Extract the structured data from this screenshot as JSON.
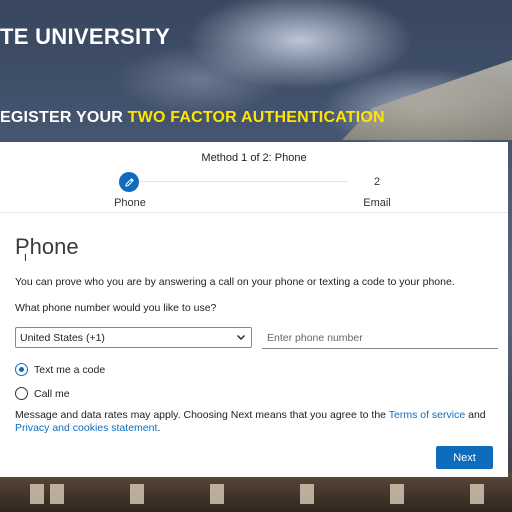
{
  "header": {
    "brand_text": "TE UNIVERSITY",
    "register_prefix": "EGISTER YOUR ",
    "register_highlight": "TWO FACTOR AUTHENTICATION"
  },
  "wizard": {
    "method_label": "Method 1 of 2: Phone",
    "steps": [
      {
        "number": "",
        "label": "Phone",
        "icon": "pencil-icon",
        "active": true
      },
      {
        "number": "2",
        "label": "Email",
        "active": false
      }
    ]
  },
  "form": {
    "title": "Phone",
    "cursor_glyph": "I",
    "description": "You can prove who you are by answering a call on your phone or texting a code to your phone.",
    "question": "What phone number would you like to use?",
    "country_value": "United States (+1)",
    "phone_placeholder": "Enter phone number",
    "options": [
      {
        "label": "Text me a code",
        "selected": true
      },
      {
        "label": "Call me",
        "selected": false
      }
    ],
    "legal_text": "Message and data rates may apply. Choosing Next means that you agree to the ",
    "terms_link": "Terms of service",
    "and_text": " and ",
    "privacy_link": "Privacy and cookies statement",
    "period": "."
  },
  "actions": {
    "next_label": "Next"
  },
  "colors": {
    "accent": "#0f6cbd",
    "highlight": "#ffe500"
  }
}
